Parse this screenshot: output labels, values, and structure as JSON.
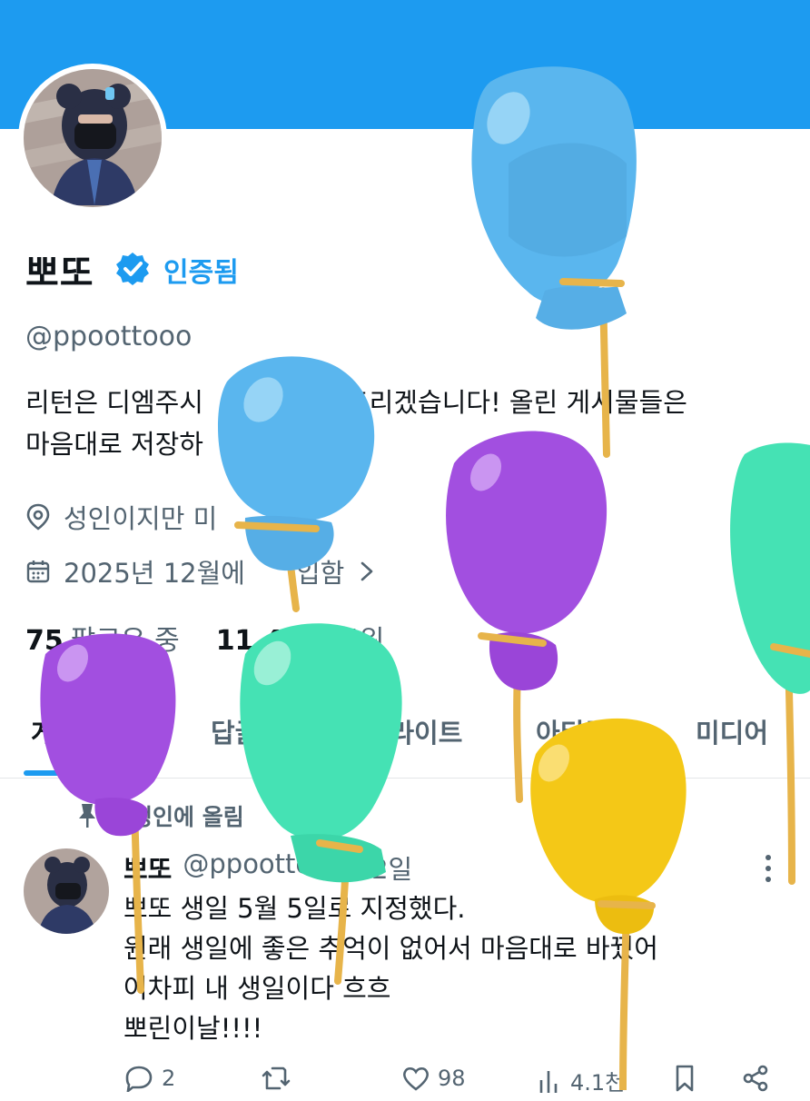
{
  "colors": {
    "accent": "#1d9bf0",
    "text_primary": "#0f1419",
    "text_secondary": "#536471",
    "balloon_blue": "#5ab6ee",
    "balloon_purple": "#a24fe0",
    "balloon_green": "#45e2b4",
    "balloon_yellow": "#f4c817",
    "balloon_string": "#e7b44a"
  },
  "profile": {
    "display_name": "뽀또",
    "verified_label": "인증됨",
    "handle": "@ppoottooo",
    "bio_lines": [
      "리턴은 디엠주시",
      "드리겠습니다! 올린 게시물들은",
      "마음대로 저장하",
      "다"
    ],
    "location": "성인이지만 미",
    "joined_prefix": "2025년 12월에",
    "joined_suffix": "입함",
    "stats": {
      "following_count": "75",
      "following_label": "팔로우 중",
      "followers_count": "11,44",
      "followers_label": "팔로워"
    },
    "icons": {
      "verified": "verified-badge-icon",
      "location": "location-pin-icon",
      "calendar": "calendar-icon",
      "chevron": "chevron-right-icon"
    }
  },
  "tabs": [
    {
      "label": "게시물",
      "active": true
    },
    {
      "label": "답글",
      "active": false
    },
    {
      "label": "하이라이트",
      "active": false
    },
    {
      "label": "아티클",
      "active": false
    },
    {
      "label": "미디어",
      "active": false
    }
  ],
  "pinned": {
    "label": "고정인에 올림",
    "icon": "pin-icon"
  },
  "tweet": {
    "name": "뽀또",
    "handle": "@ppoottooo",
    "time": "· 2일",
    "lines": [
      "뽀또 생일 5월 5일로 지정했다.",
      "원래 생일에 좋은 추억이 없어서 마음대로 바꿨어",
      "어차피 내 생일이다 흐흐",
      "뽀린이날!!!!"
    ],
    "actions": {
      "replies": "2",
      "reposts": "",
      "likes": "98",
      "views": "4.1천"
    }
  }
}
